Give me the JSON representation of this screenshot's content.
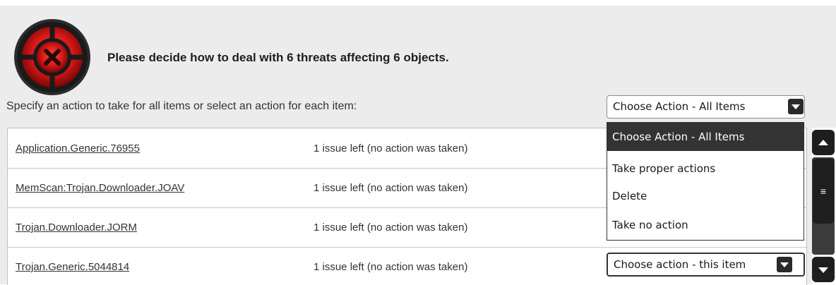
{
  "header": {
    "icon": "threat-x-icon",
    "headline": "Please decide how to deal with 6 threats affecting 6 objects."
  },
  "instruction": "Specify an action to take for all items or select an action for each item:",
  "all_items_select": {
    "value": "Choose Action - All Items"
  },
  "dropdown": {
    "options": [
      {
        "label": "Choose Action - All Items",
        "selected": true
      },
      {
        "label": "Take proper actions"
      },
      {
        "label": "Delete"
      },
      {
        "label": "Take no action"
      }
    ]
  },
  "threats": [
    {
      "name": "Application.Generic.76955",
      "status": "1 issue left (no action was taken)"
    },
    {
      "name": "MemScan:Trojan.Downloader.JOAV",
      "status": "1 issue left (no action was taken)"
    },
    {
      "name": "Trojan.Downloader.JORM",
      "status": "1 issue left (no action was taken)"
    },
    {
      "name": "Trojan.Generic.5044814",
      "status": "1 issue left (no action was taken)",
      "action": "Choose action - this item"
    }
  ],
  "scrollbar": {
    "thumb_glyph": "≡"
  },
  "colors": {
    "accent_red": "#e0202a",
    "dark": "#1e1e1e",
    "panel": "#ececec"
  }
}
